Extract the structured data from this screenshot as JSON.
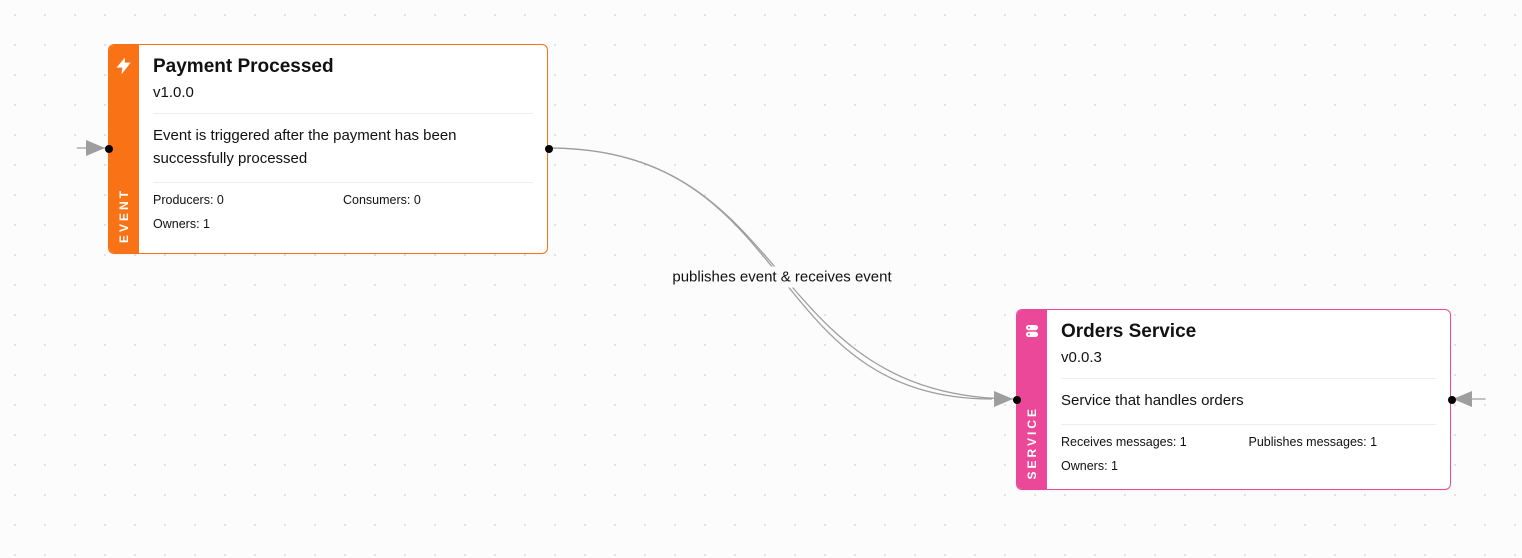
{
  "edge_label": "publishes event & receives event",
  "event_node": {
    "sidebar_label": "EVENT",
    "title": "Payment Processed",
    "version": "v1.0.0",
    "description": "Event is triggered after the payment has been successfully processed",
    "producers_label": "Producers: 0",
    "consumers_label": "Consumers: 0",
    "owners_label": "Owners: 1"
  },
  "service_node": {
    "sidebar_label": "SERVICE",
    "title": "Orders Service",
    "version": "v0.0.3",
    "description": "Service that handles orders",
    "receives_label": "Receives messages: 1",
    "publishes_label": "Publishes messages: 1",
    "owners_label": "Owners: 1"
  }
}
